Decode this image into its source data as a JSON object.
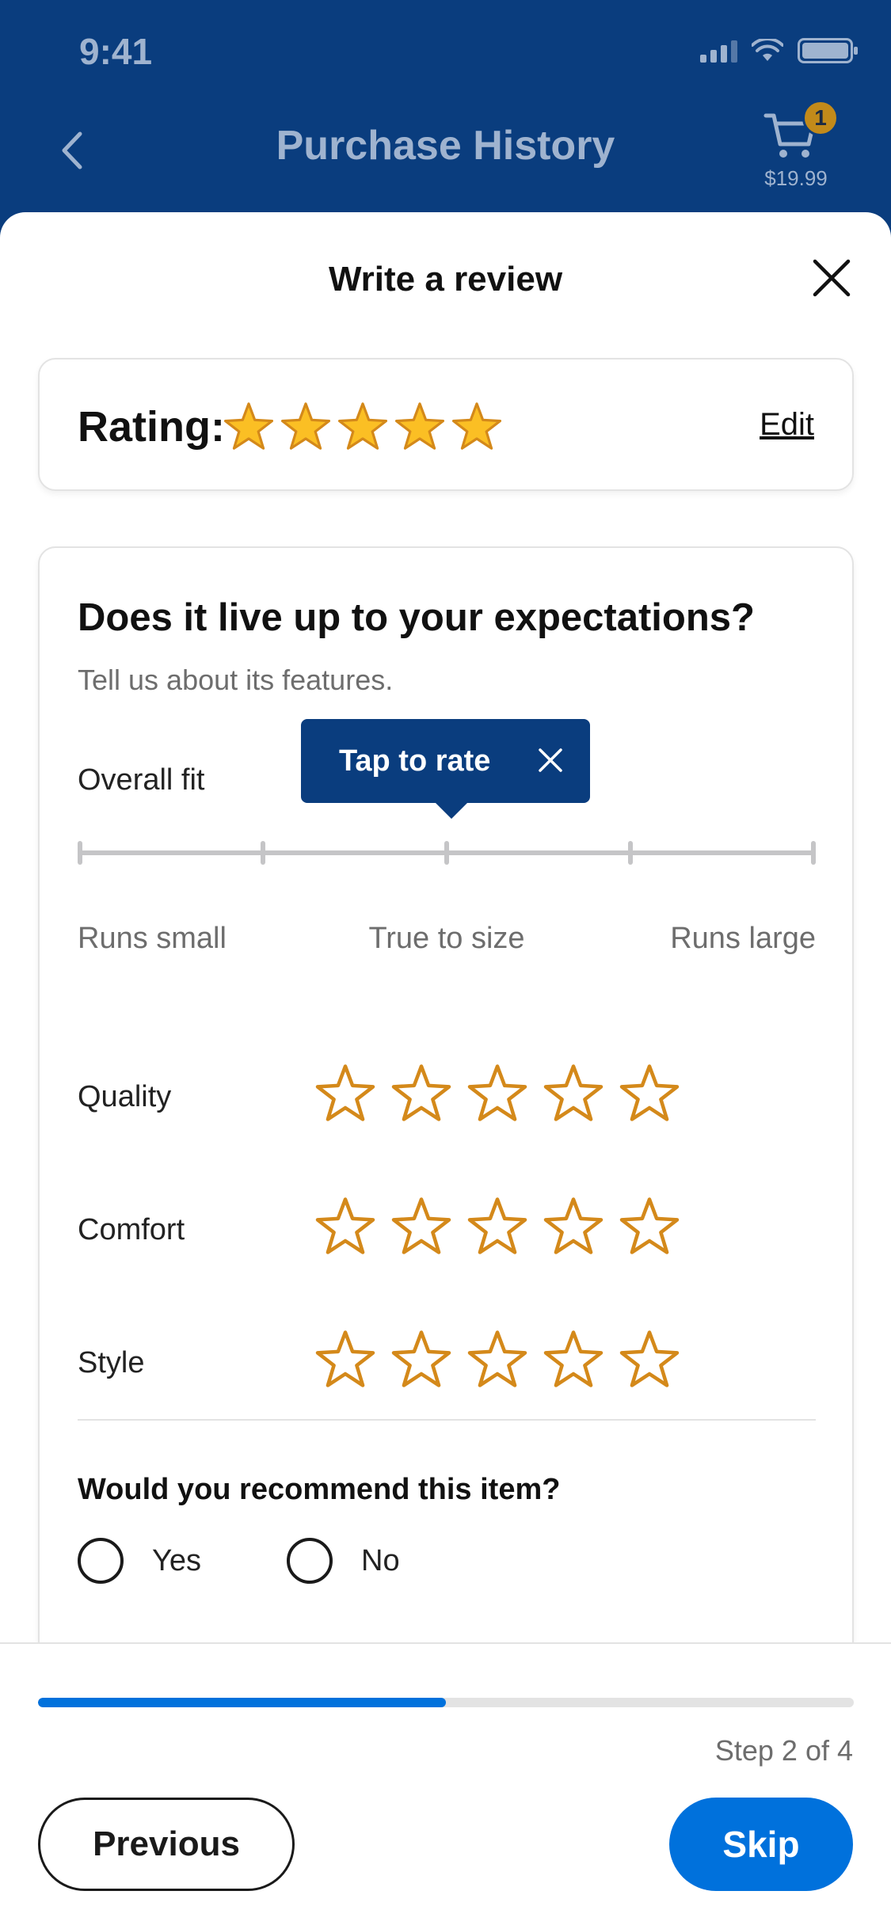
{
  "status_bar": {
    "time": "9:41"
  },
  "nav": {
    "title": "Purchase History",
    "cart_count": "1",
    "cart_total": "$19.99"
  },
  "sheet": {
    "title": "Write a review"
  },
  "rating": {
    "label": "Rating:",
    "stars_filled": 5,
    "stars_total": 5,
    "edit_label": "Edit"
  },
  "features": {
    "title": "Does it live up to your expectations?",
    "subtitle": "Tell us about its features.",
    "fit": {
      "label": "Overall fit",
      "tooltip": "Tap to rate",
      "low": "Runs small",
      "mid": "True to size",
      "high": "Runs large"
    },
    "attributes": [
      {
        "label": "Quality",
        "stars_filled": 0
      },
      {
        "label": "Comfort",
        "stars_filled": 0
      },
      {
        "label": "Style",
        "stars_filled": 0
      }
    ],
    "recommend": {
      "question": "Would you recommend this item?",
      "yes": "Yes",
      "no": "No"
    }
  },
  "footer": {
    "progress": 0.5,
    "step_text": "Step 2 of 4",
    "previous_label": "Previous",
    "skip_label": "Skip"
  },
  "colors": {
    "header_bg": "#0a3d7e",
    "accent": "#0071dc",
    "star_fill": "#fbbf24",
    "star_outline": "#d4891a"
  }
}
